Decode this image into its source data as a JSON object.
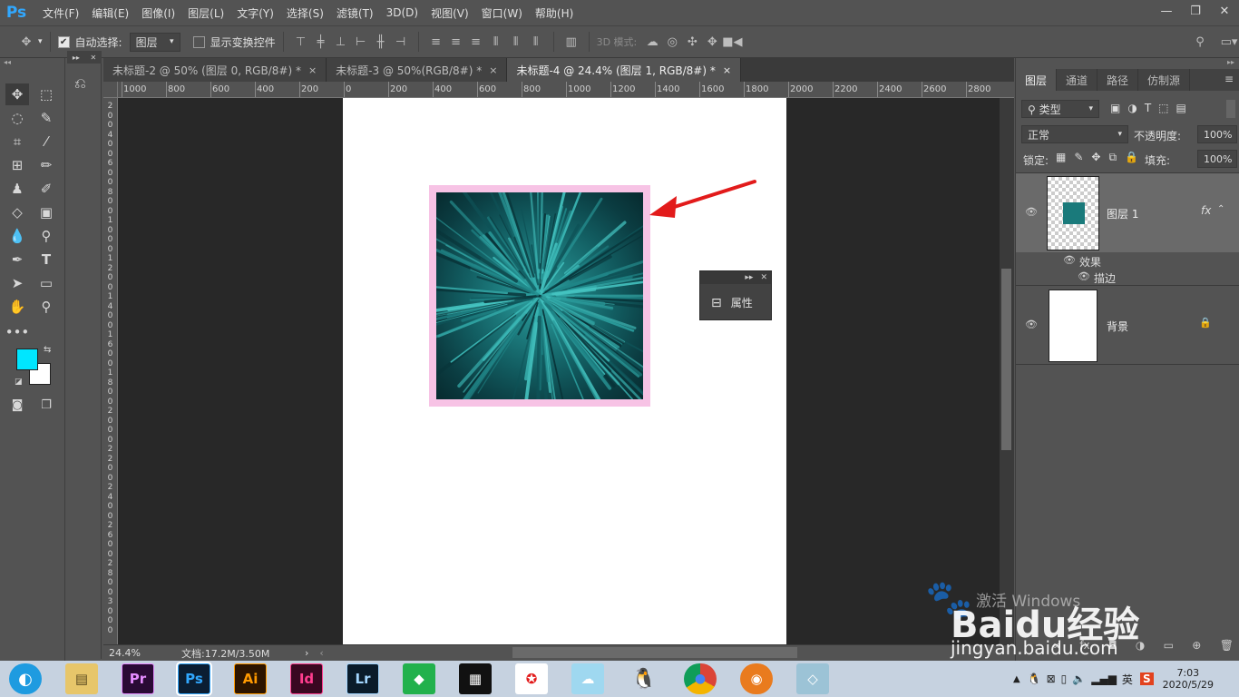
{
  "app": {
    "logo": "Ps",
    "menus": [
      "文件(F)",
      "编辑(E)",
      "图像(I)",
      "图层(L)",
      "文字(Y)",
      "选择(S)",
      "滤镜(T)",
      "3D(D)",
      "视图(V)",
      "窗口(W)",
      "帮助(H)"
    ]
  },
  "options": {
    "auto_select_label": "自动选择:",
    "auto_select_target": "图层",
    "show_transform_label": "显示变换控件",
    "mode_3d_label": "3D 模式:"
  },
  "tabs": [
    {
      "label": "未标题-2 @ 50% (图层 0, RGB/8#) *",
      "close": "×"
    },
    {
      "label": "未标题-3 @ 50%(RGB/8#) *",
      "close": "×"
    },
    {
      "label": "未标题-4 @ 24.4% (图层 1, RGB/8#) *",
      "close": "×"
    }
  ],
  "ruler": {
    "h_labels": [
      "1000",
      "800",
      "600",
      "400",
      "200",
      "0",
      "200",
      "400",
      "600",
      "800",
      "1000",
      "1200",
      "1400",
      "1600",
      "1800",
      "2000",
      "2200",
      "2400",
      "2600",
      "2800"
    ],
    "v_labels": [
      "2",
      "0",
      "0",
      "4",
      "0",
      "0",
      "6",
      "0",
      "0",
      "8",
      "0",
      "0",
      "1",
      "0",
      "0",
      "0",
      "1",
      "2",
      "0",
      "0",
      "1",
      "4",
      "0",
      "0",
      "1",
      "6",
      "0",
      "0",
      "1",
      "8",
      "0",
      "0",
      "2",
      "0",
      "0",
      "0",
      "2",
      "2",
      "0",
      "0",
      "2",
      "4",
      "0",
      "0",
      "2",
      "6",
      "0",
      "0",
      "2",
      "8",
      "0",
      "0",
      "3",
      "0",
      "0",
      "0"
    ]
  },
  "status": {
    "zoom": "24.4%",
    "doc_info": "文档:17.2M/3.50M",
    "arrow": "›"
  },
  "properties_panel": {
    "label": "属性"
  },
  "layers_panel": {
    "tabs": [
      "图层",
      "通道",
      "路径",
      "仿制源"
    ],
    "filter_kind": "类型",
    "blend_mode": "正常",
    "opacity_label": "不透明度:",
    "opacity_value": "100%",
    "lock_label": "锁定:",
    "fill_label": "填充:",
    "fill_value": "100%",
    "layers": [
      {
        "name": "图层 1",
        "fx": "fx",
        "effects_label": "效果",
        "effect_item": "描边"
      },
      {
        "name": "背景"
      }
    ]
  },
  "taskbar": {
    "apps": [
      "Pr",
      "Ps",
      "Ai",
      "Id",
      "Lr"
    ],
    "ime": "英",
    "time": "7:03",
    "date": "2020/5/29"
  },
  "watermark": {
    "activate_text": "激活 Windows",
    "brand": "Baidu经验",
    "url": "jingyan.baidu.com"
  },
  "colors": {
    "foreground": "#00e6ff",
    "background": "#ffffff",
    "stroke": "#f7c3e5",
    "arrow": "#e21b1b"
  }
}
